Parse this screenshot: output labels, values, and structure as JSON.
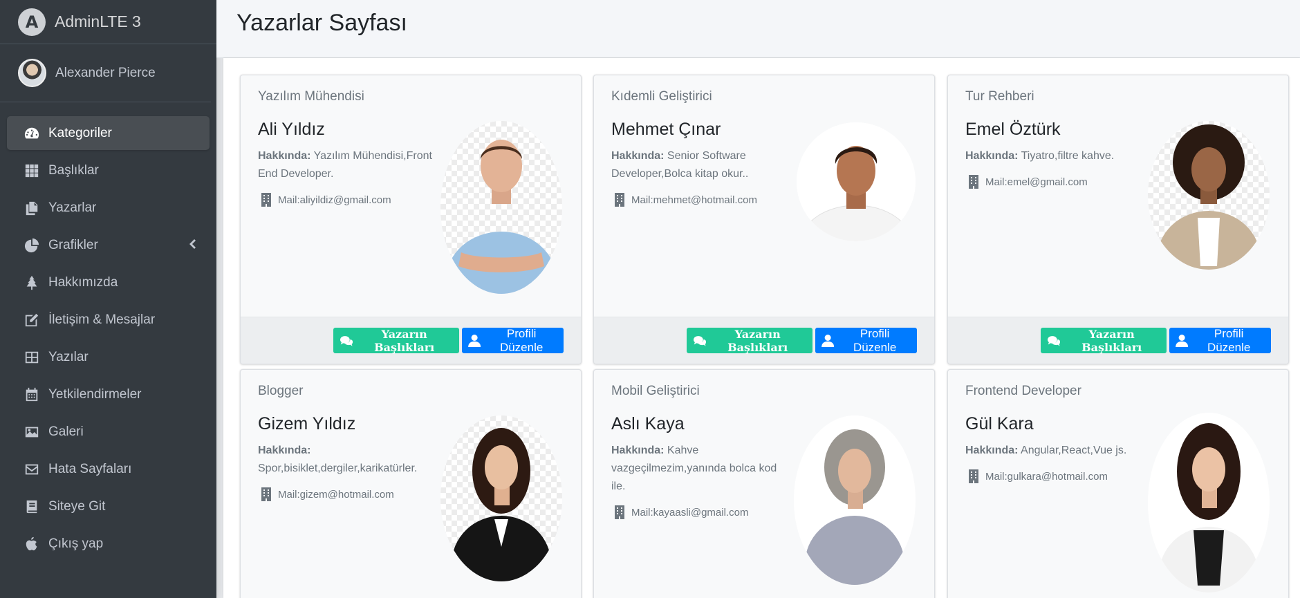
{
  "brand": {
    "title": "AdminLTE 3"
  },
  "user": {
    "name": "Alexander Pierce"
  },
  "sidebar": {
    "items": [
      {
        "label": "Kategoriler",
        "icon": "dashboard-icon",
        "active": true
      },
      {
        "label": "Başlıklar",
        "icon": "grid-icon"
      },
      {
        "label": "Yazarlar",
        "icon": "copy-icon"
      },
      {
        "label": "Grafikler",
        "icon": "pie-chart-icon",
        "has_children": true
      },
      {
        "label": "Hakkımızda",
        "icon": "tree-icon"
      },
      {
        "label": "İletişim & Mesajlar",
        "icon": "edit-icon"
      },
      {
        "label": "Yazılar",
        "icon": "table-icon"
      },
      {
        "label": "Yetkilendirmeler",
        "icon": "calendar-icon"
      },
      {
        "label": "Galeri",
        "icon": "image-icon"
      },
      {
        "label": "Hata Sayfaları",
        "icon": "envelope-icon"
      },
      {
        "label": "Siteye Git",
        "icon": "book-icon"
      },
      {
        "label": "Çıkış yap",
        "icon": "apple-icon"
      }
    ]
  },
  "page": {
    "title": "Yazarlar Sayfası"
  },
  "labels": {
    "about": "Hakkında:",
    "posts_button": "Yazarın Başlıkları",
    "edit_button": "Profili Düzenle"
  },
  "authors": [
    {
      "role": "Yazılım Mühendisi",
      "name": "Ali Yıldız",
      "about": "Yazılım Mühendisi,Front End Developer.",
      "mail": "Mail:aliyildiz@gmail.com"
    },
    {
      "role": "Kıdemli Geliştirici",
      "name": "Mehmet Çınar",
      "about": "Senior Software Developer,Bolca kitap okur..",
      "mail": "Mail:mehmet@hotmail.com"
    },
    {
      "role": "Tur Rehberi",
      "name": "Emel Öztürk",
      "about": "Tiyatro,filtre kahve.",
      "mail": "Mail:emel@gmail.com"
    },
    {
      "role": "Blogger",
      "name": "Gizem Yıldız",
      "about": "Spor,bisiklet,dergiler,karikatürler.",
      "mail": "Mail:gizem@hotmail.com"
    },
    {
      "role": "Mobil Geliştirici",
      "name": "Aslı Kaya",
      "about": "Kahve vazgeçilmezim,yanında bolca kod ile.",
      "mail": "Mail:kayaasli@gmail.com"
    },
    {
      "role": "Frontend Developer",
      "name": "Gül Kara",
      "about": "Angular,React,Vue js.",
      "mail": "Mail:gulkara@hotmail.com"
    }
  ],
  "colors": {
    "sidebar_bg": "#343a40",
    "success": "#20c997",
    "primary": "#007bff"
  }
}
